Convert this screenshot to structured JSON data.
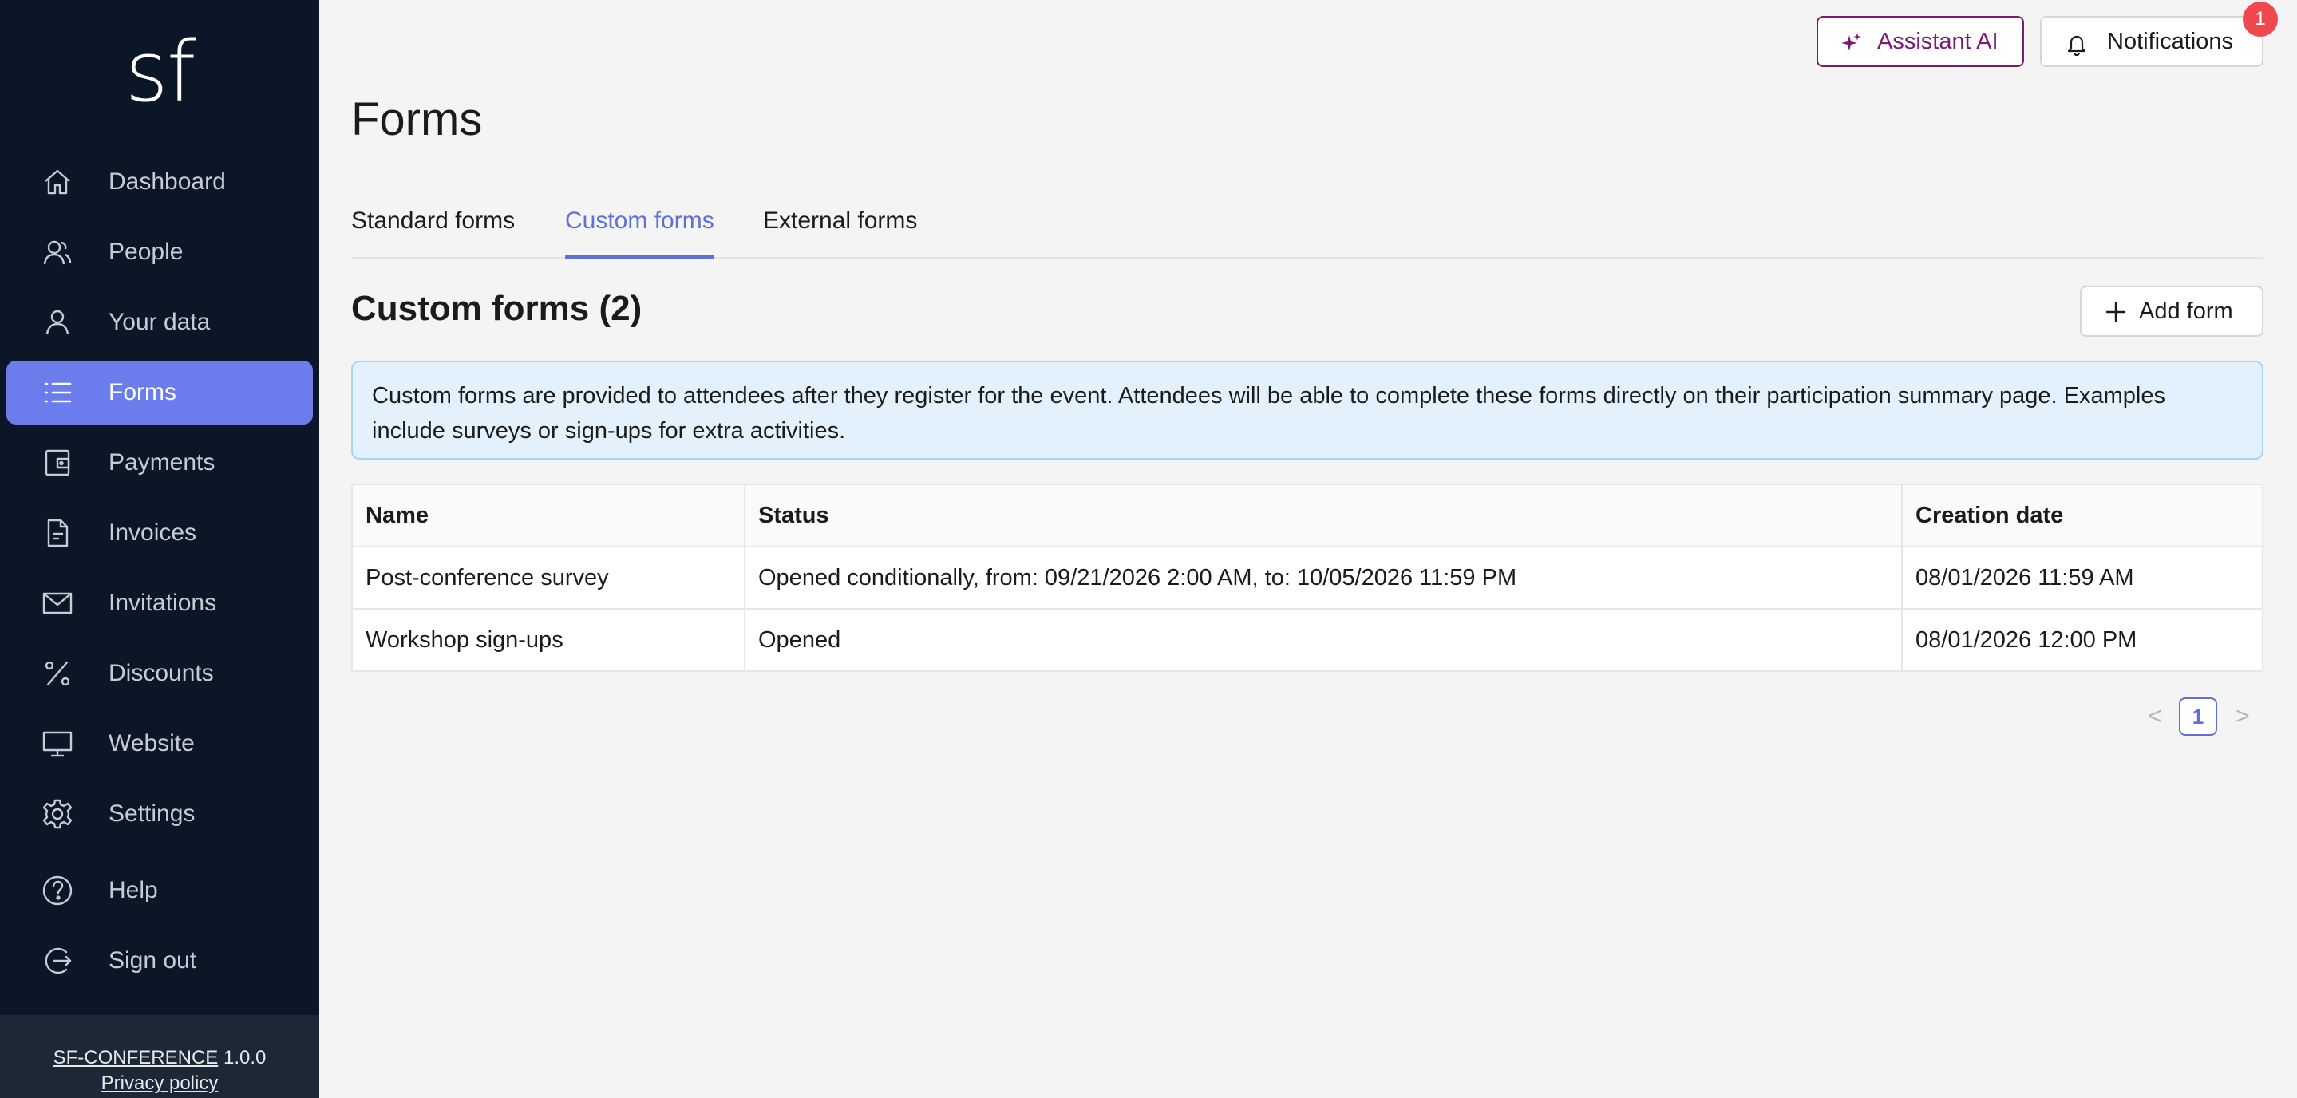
{
  "app": {
    "logo": "sf"
  },
  "sidebar": {
    "items": [
      {
        "label": "Dashboard"
      },
      {
        "label": "People"
      },
      {
        "label": "Your data"
      },
      {
        "label": "Forms",
        "active": true
      },
      {
        "label": "Payments"
      },
      {
        "label": "Invoices"
      },
      {
        "label": "Invitations"
      },
      {
        "label": "Discounts"
      },
      {
        "label": "Website"
      },
      {
        "label": "Settings"
      },
      {
        "label": "Help"
      },
      {
        "label": "Sign out"
      }
    ],
    "footer": {
      "product": "SF-CONFERENCE",
      "version": "1.0.0",
      "privacy": "Privacy policy"
    }
  },
  "header": {
    "assistant_label": "Assistant AI",
    "notifications_label": "Notifications",
    "notifications_count": "1"
  },
  "page": {
    "title": "Forms",
    "tabs": [
      {
        "label": "Standard forms"
      },
      {
        "label": "Custom forms",
        "active": true
      },
      {
        "label": "External forms"
      }
    ],
    "section_title": "Custom forms (2)",
    "add_label": "Add form",
    "info": "Custom forms are provided to attendees after they register for the event. Attendees will be able to complete these forms directly on their participation summary page. Examples include surveys or sign-ups for extra activities."
  },
  "table": {
    "headers": [
      "Name",
      "Status",
      "Creation date"
    ],
    "rows": [
      {
        "name": "Post-conference survey",
        "status": "Opened conditionally, from: 09/21/2026 2:00 AM, to: 10/05/2026 11:59 PM",
        "created": "08/01/2026 11:59 AM"
      },
      {
        "name": "Workshop sign-ups",
        "status": "Opened",
        "created": "08/01/2026 12:00 PM"
      }
    ]
  },
  "pagination": {
    "current": "1",
    "prev": "<",
    "next": ">"
  },
  "colors": {
    "sidebar_bg": "#0b1727",
    "accent": "#6b7ced",
    "assistant": "#7b1a73",
    "badge": "#f0484e",
    "info_bg": "#e3f1fd"
  }
}
